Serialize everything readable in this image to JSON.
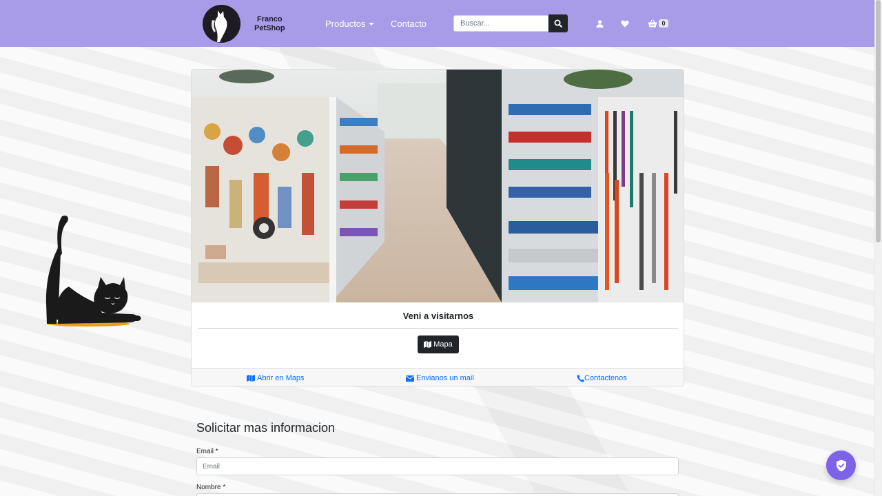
{
  "brand": {
    "line1": "Franco",
    "line2": "PetShop",
    "logo_icon": "cat-dog-silhouette-icon"
  },
  "nav": {
    "products_label": "Productos",
    "contact_label": "Contacto",
    "search_placeholder": "Buscar...",
    "search_icon": "search-icon",
    "user_icon": "user-icon",
    "wishlist_icon": "heart-icon",
    "cart_icon": "basket-icon",
    "cart_count": "0"
  },
  "card": {
    "image_description_icon": "pet-store-aisle-photo",
    "title": "Veni a visitarnos",
    "map_button_label": "Mapa",
    "footer": {
      "open_maps_label": "Abrir en Maps",
      "email_label": "Envianos un mail",
      "contact_label": "Contactenos"
    }
  },
  "form": {
    "title": "Solicitar mas informacion",
    "email_label": "Email *",
    "email_placeholder": "Email",
    "name_label": "Nombre *"
  },
  "colors": {
    "navbar": "#a89be8",
    "dark_button": "#212529",
    "link": "#0d6efd",
    "floating_button": "#7d63e8"
  }
}
